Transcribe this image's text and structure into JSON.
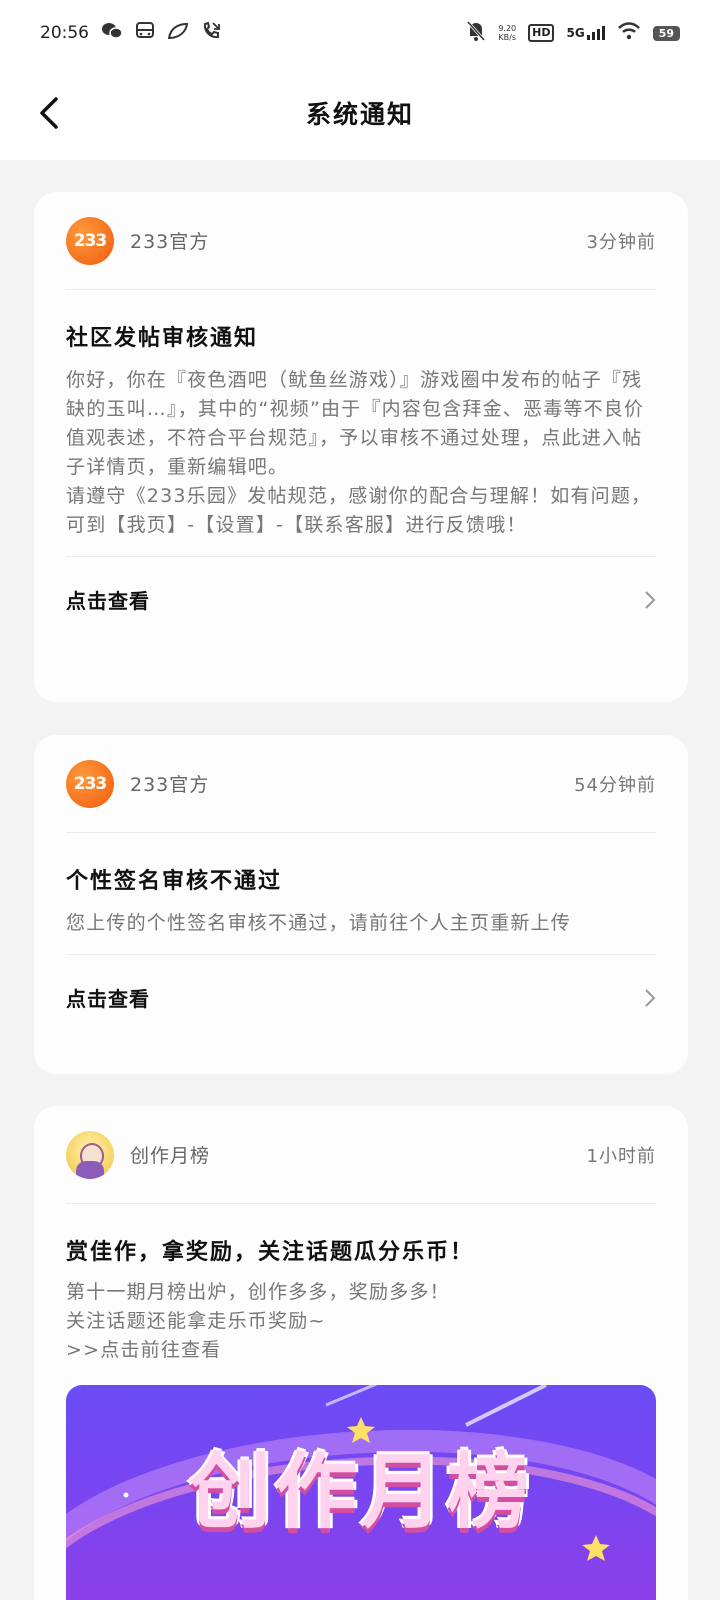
{
  "status_bar": {
    "time": "20:56",
    "speed_top": "9.20",
    "speed_bottom": "KB/s",
    "hd": "HD",
    "net": "5G",
    "battery": "59"
  },
  "nav": {
    "title": "系统通知"
  },
  "notifications": [
    {
      "sender": "233官方",
      "time": "3分钟前",
      "title": "社区发帖审核通知",
      "body": "你好，你在『夜色酒吧（鱿鱼丝游戏）』游戏圈中发布的帖子『残缺的玉叫…』，其中的“视频”由于『内容包含拜金、恶毒等不良价值观表述，不符合平台规范』，予以审核不通过处理，点此进入帖子详情页，重新编辑吧。\n请遵守《233乐园》发帖规范，感谢你的配合与理解！如有问题，可到【我页】-【设置】-【联系客服】进行反馈哦！",
      "action": "点击查看"
    },
    {
      "sender": "233官方",
      "time": "54分钟前",
      "title": "个性签名审核不通过",
      "body": "您上传的个性签名审核不通过，请前往个人主页重新上传",
      "action": "点击查看"
    },
    {
      "sender": "创作月榜",
      "time": "1小时前",
      "title": "赏佳作，拿奖励，关注话题瓜分乐币！",
      "body": "第十一期月榜出炉，创作多多，奖励多多！\n关注话题还能拿走乐币奖励~\n>>点击前往查看",
      "banner_text": "创作月榜"
    }
  ],
  "logo_text": "233",
  "colors": {
    "accent_orange": "#f15a0c",
    "banner_purple": "#6b4cf5",
    "background": "#f3f3f3"
  }
}
